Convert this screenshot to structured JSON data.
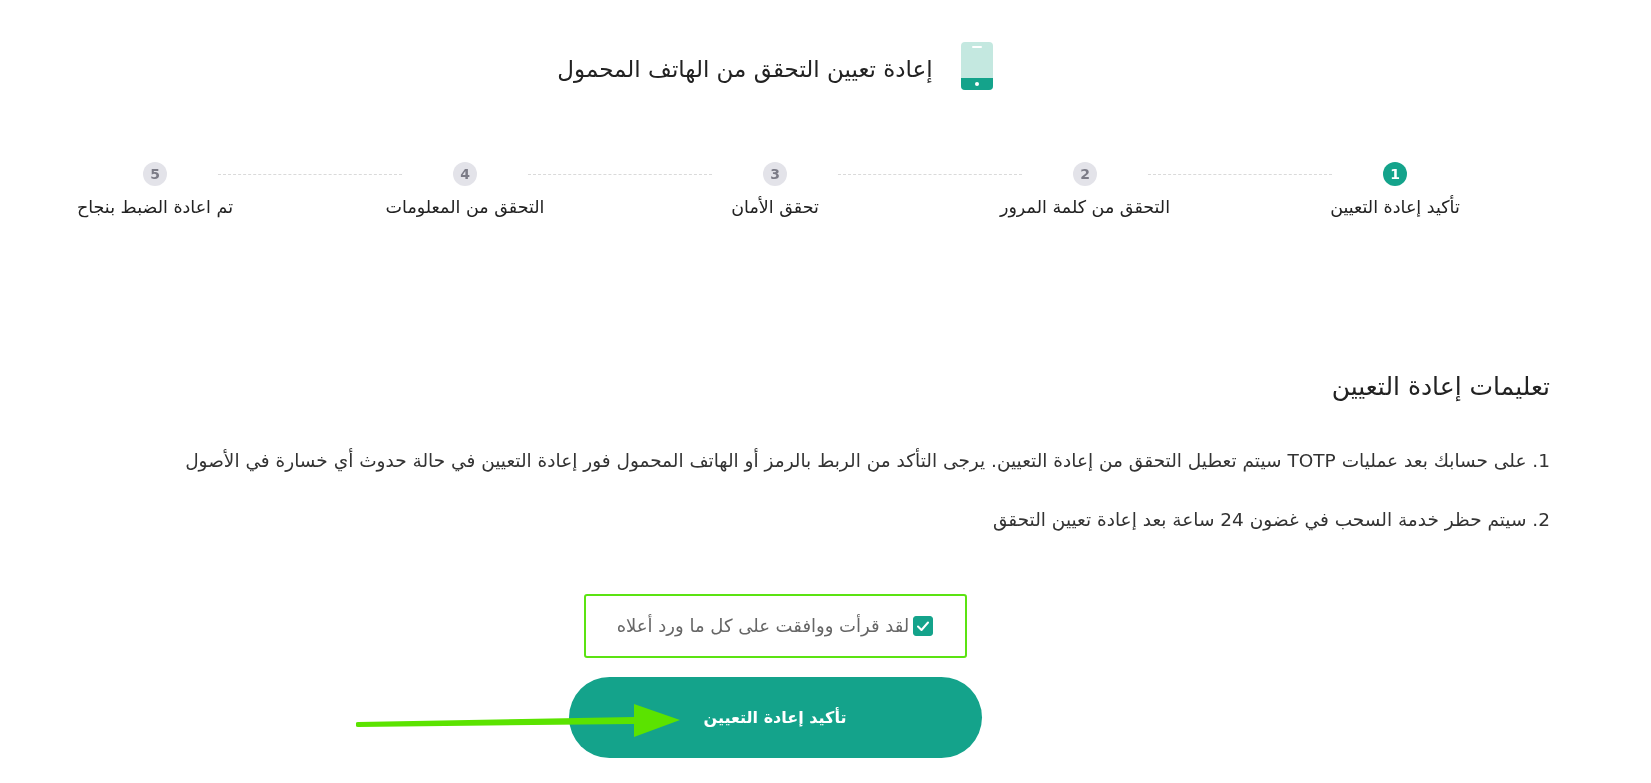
{
  "header": {
    "title": "إعادة تعيين التحقق من الهاتف المحمول"
  },
  "steps": [
    {
      "number": "1",
      "label": "تأكيد إعادة التعيين",
      "active": true
    },
    {
      "number": "2",
      "label": "التحقق من كلمة المرور",
      "active": false
    },
    {
      "number": "3",
      "label": "تحقق الأمان",
      "active": false
    },
    {
      "number": "4",
      "label": "التحقق من المعلومات",
      "active": false
    },
    {
      "number": "5",
      "label": "تم اعادة الضبط بنجاح",
      "active": false
    }
  ],
  "instructions": {
    "heading": "تعليمات إعادة التعيين",
    "items": [
      "1. على حسابك بعد عمليات TOTP سيتم تعطيل التحقق من إعادة التعيين. يرجى التأكد من الربط بالرمز أو الهاتف المحمول فور إعادة التعيين في حالة حدوث أي خسارة في الأصول",
      "2. سيتم حظر خدمة السحب في غضون 24 ساعة بعد إعادة تعيين التحقق"
    ]
  },
  "agreement": {
    "label": "لقد قرأت ووافقت على كل ما ورد أعلاه",
    "checked": true
  },
  "confirm_button": {
    "label": "تأكيد إعادة التعيين"
  }
}
